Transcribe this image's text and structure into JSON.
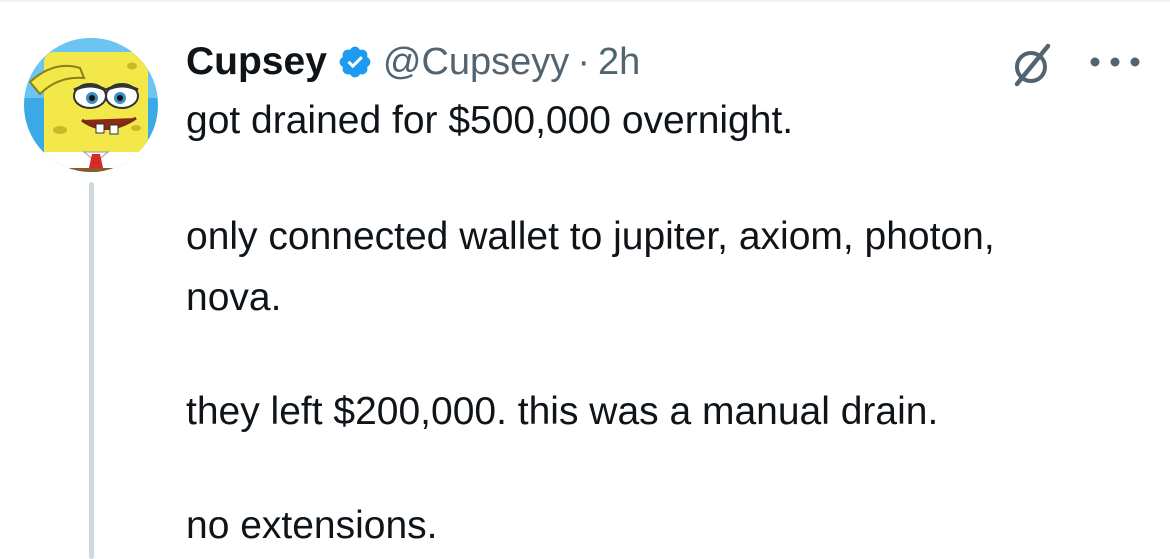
{
  "tweet": {
    "author": {
      "display_name": "Cupsey",
      "verified": true,
      "handle": "@Cupseyy",
      "separator": "·",
      "time": "2h"
    },
    "lines": [
      "got drained for $500,000 overnight.",
      "only connected wallet to jupiter, axiom, photon,",
      "nova.",
      "they left $200,000. this was a manual drain.",
      "no extensions."
    ]
  },
  "icons": {
    "avatar": "spongebob-avatar",
    "verified": "verified-badge-icon",
    "grok": "grok-icon",
    "more": "more-options-icon"
  },
  "colors": {
    "text": "#0f1419",
    "secondary": "#536471",
    "verified": "#1d9bf0",
    "thread_line": "#cfd9de"
  }
}
